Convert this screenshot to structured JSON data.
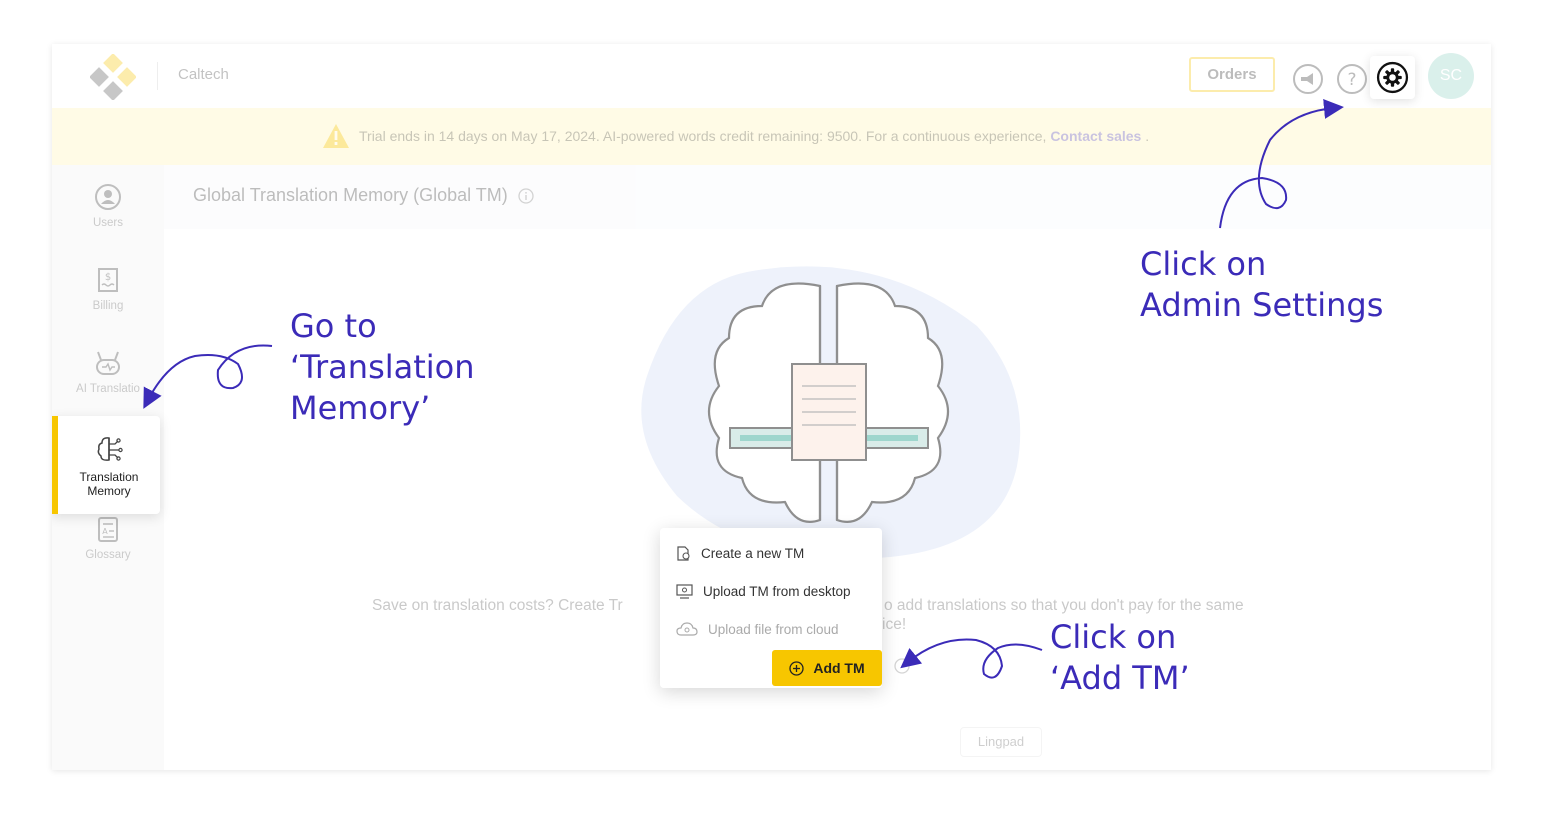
{
  "header": {
    "company": "Caltech",
    "orders_label": "Orders",
    "avatar_initials": "SC"
  },
  "banner": {
    "message": "Trial ends in 14 days on May 17, 2024. AI-powered words credit remaining: 9500. For a continuous experience,",
    "link": "Contact sales",
    "suffix": "."
  },
  "sidebar": {
    "items": [
      {
        "label": "Users",
        "icon": "user-circle-icon"
      },
      {
        "label": "Billing",
        "icon": "receipt-icon"
      },
      {
        "label": "AI Translatio",
        "icon": "robot-icon"
      },
      {
        "label": "Translation Memory",
        "icon": "brain-icon"
      },
      {
        "label": "Glossary",
        "icon": "glossary-icon"
      }
    ]
  },
  "main": {
    "title": "Global Translation Memory (Global TM)",
    "description_left": "Save on translation costs? Create Tr",
    "description_right": "o add translations so that you don't pay for the same",
    "description_line2": "ice!",
    "add_button": "Add TM",
    "footer_pill": "Lingpad"
  },
  "dropdown": {
    "items": [
      {
        "label": "Create a new TM",
        "icon": "new-file-icon",
        "disabled": false
      },
      {
        "label": "Upload TM from desktop",
        "icon": "desktop-icon",
        "disabled": false
      },
      {
        "label": "Upload file from cloud",
        "icon": "cloud-icon",
        "disabled": true
      }
    ]
  },
  "annotations": {
    "tm": "Go to\n‘Translation\nMemory’",
    "settings": "Click on\nAdmin Settings",
    "add": "Click on\n‘Add TM’"
  },
  "colors": {
    "accent_yellow": "#f7c600",
    "annotation_purple": "#3b2bb8",
    "link_purple": "#5b4fd6",
    "banner_bg": "#fffbe6"
  }
}
